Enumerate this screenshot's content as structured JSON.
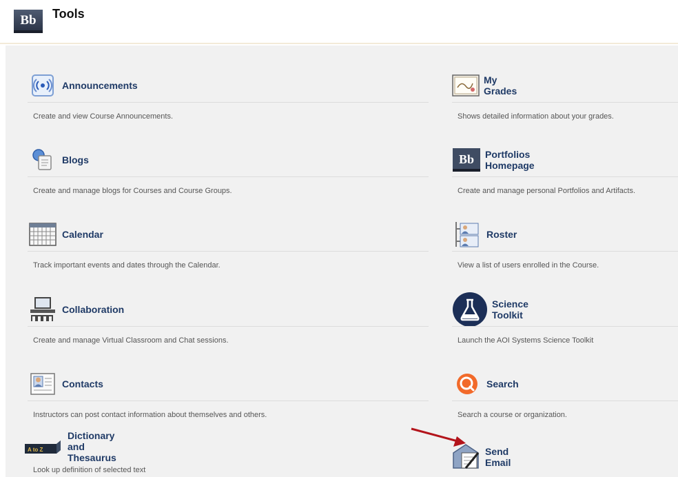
{
  "header": {
    "logo_text": "Bb",
    "title": "Tools"
  },
  "tools_left": [
    {
      "label": "Announcements",
      "description": "Create and view Course Announcements.",
      "icon": "announcements-icon"
    },
    {
      "label": "Blogs",
      "description": "Create and manage blogs for Courses and Course Groups.",
      "icon": "blogs-icon"
    },
    {
      "label": "Calendar",
      "description": "Track important events and dates through the Calendar.",
      "icon": "calendar-icon"
    },
    {
      "label": "Collaboration",
      "description": "Create and manage Virtual Classroom and Chat sessions.",
      "icon": "collaboration-icon"
    },
    {
      "label": "Contacts",
      "description": "Instructors can post contact information about themselves and others.",
      "icon": "contacts-icon"
    },
    {
      "label": "Dictionary and Thesaurus",
      "description": "Look up definition of selected text",
      "icon": "dictionary-icon",
      "icon_text": "A to Z"
    }
  ],
  "tools_right": [
    {
      "label": "My Grades",
      "description": "Shows detailed information about your grades.",
      "icon": "grades-icon"
    },
    {
      "label": "Portfolios Homepage",
      "description": "Create and manage personal Portfolios and Artifacts.",
      "icon": "portfolios-icon",
      "icon_text": "Bb"
    },
    {
      "label": "Roster",
      "description": "View a list of users enrolled in the Course.",
      "icon": "roster-icon"
    },
    {
      "label": "Science Toolkit",
      "description": "Launch the AOI Systems Science Toolkit",
      "icon": "science-toolkit-icon"
    },
    {
      "label": "Search",
      "description": "Search a course or organization.",
      "icon": "search-icon"
    },
    {
      "label": "Send Email",
      "description": "",
      "icon": "send-email-icon"
    }
  ],
  "colors": {
    "link": "#1f3a66",
    "panel": "#f1f1f1",
    "arrow": "#b3141b"
  }
}
